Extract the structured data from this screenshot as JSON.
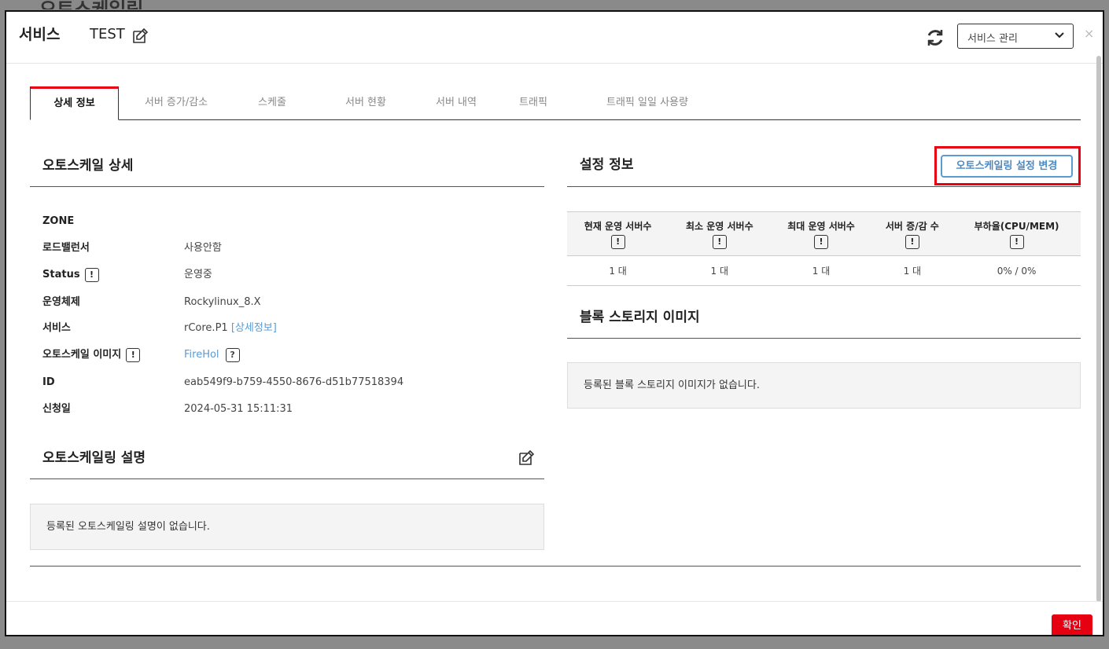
{
  "background": {
    "title": "오토스케일링"
  },
  "header": {
    "title": "서비스",
    "service_name": "TEST",
    "select_value": "서비스 관리",
    "close_label": "×"
  },
  "tabs": [
    {
      "label": "상세 정보",
      "active": true
    },
    {
      "label": "서버 증가/감소"
    },
    {
      "label": "스케줄"
    },
    {
      "label": "서버 현황"
    },
    {
      "label": "서버 내역"
    },
    {
      "label": "트래픽"
    },
    {
      "label": "트래픽 일일 사용량"
    }
  ],
  "detail": {
    "title": "오토스케일 상세",
    "rows": [
      {
        "label": "ZONE",
        "value": ""
      },
      {
        "label": "로드밸런서",
        "value": "사용안함"
      },
      {
        "label": "Status",
        "value": "운영중"
      },
      {
        "label": "운영체제",
        "value": "Rockylinux_8.X"
      },
      {
        "label": "서비스",
        "value": "rCore.P1",
        "link": "[상세정보]"
      },
      {
        "label": "오토스케일 이미지",
        "value": "FireHol"
      },
      {
        "label": "ID",
        "value": "eab549f9-b759-4550-8676-d51b77518394"
      },
      {
        "label": "신청일",
        "value": "2024-05-31 15:11:31"
      }
    ],
    "badge_excl": "!",
    "badge_q": "?"
  },
  "description": {
    "title": "오토스케일링 설명",
    "empty": "등록된 오토스케일링 설명이 없습니다."
  },
  "settings": {
    "title": "설정 정보",
    "change_button": "오토스케일링 설정 변경",
    "columns": [
      "현재 운영 서버수",
      "최소 운영 서버수",
      "최대 운영 서버수",
      "서버 증/감 수",
      "부하율(CPU/MEM)"
    ],
    "values": [
      "1 대",
      "1 대",
      "1 대",
      "1 대",
      "0% / 0%"
    ]
  },
  "block_storage": {
    "title": "블록 스토리지 이미지",
    "empty": "등록된 블록 스토리지 이미지가 없습니다."
  },
  "footer": {
    "confirm": "확인"
  },
  "colors": {
    "accent_red": "#e60012",
    "link_blue": "#5a9bd5"
  }
}
